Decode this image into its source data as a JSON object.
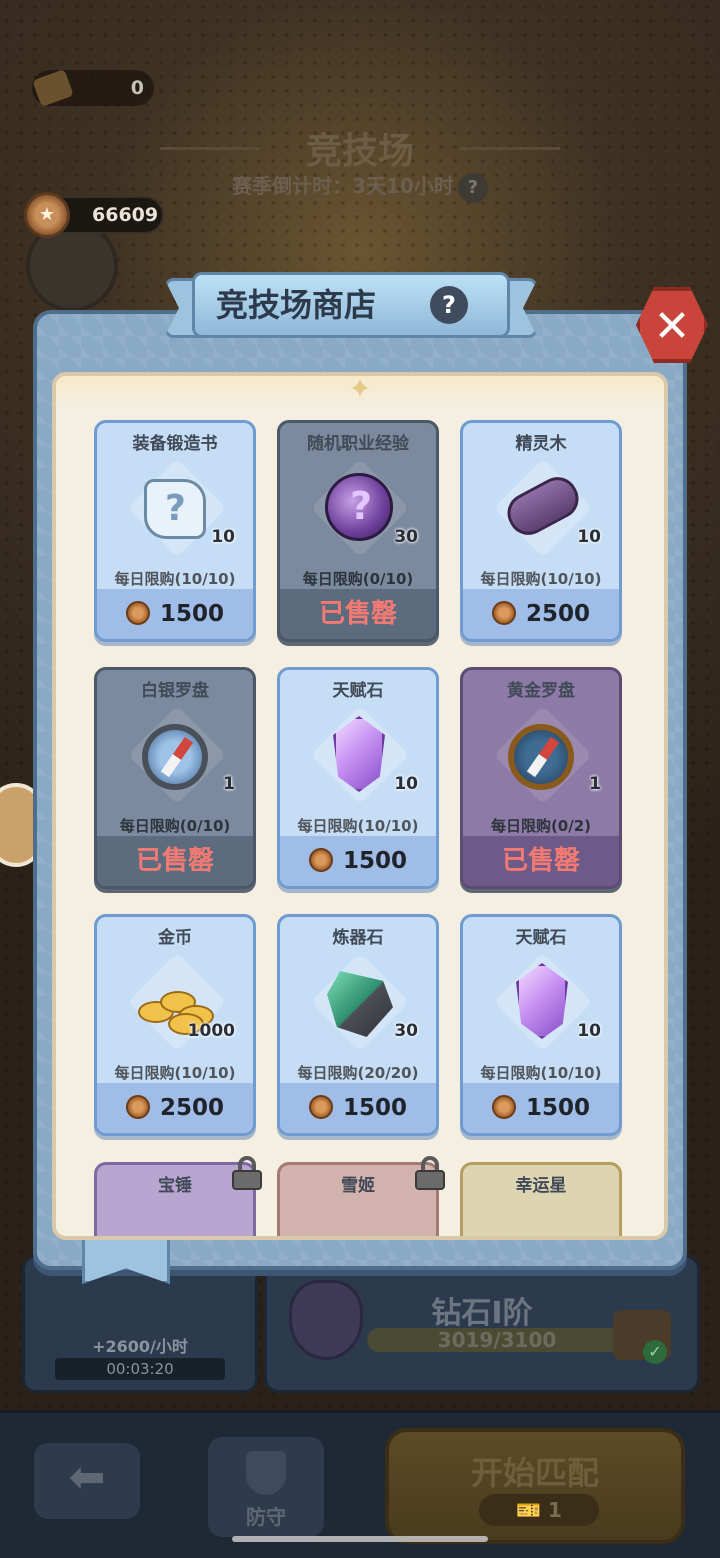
{
  "background": {
    "ticket_count": "0",
    "arena_title": "竞技场",
    "season_countdown": "赛季倒计时：3天10小时",
    "coin_balance": "66609",
    "income_rate": "+2600/小时",
    "income_timer": "00:03:20",
    "rank_name": "钻石I阶",
    "rank_progress": "3019/3100",
    "rank_progress_fraction": 0.974,
    "back_button_glyph": "⬅",
    "defend_label": "防守",
    "match_label": "开始匹配",
    "match_cost": "1"
  },
  "modal": {
    "title": "竞技场商店",
    "help_glyph": "?",
    "close_glyph": "✕"
  },
  "items": [
    {
      "name": "装备锻造书",
      "icon": "scroll-icon",
      "count": "10",
      "limit": "每日限购(10/10)",
      "price": "1500",
      "sold_out": false
    },
    {
      "name": "随机职业经验",
      "icon": "orb-icon",
      "count": "30",
      "limit": "每日限购(0/10)",
      "price": "已售罄",
      "sold_out": true
    },
    {
      "name": "精灵木",
      "icon": "wood-icon",
      "count": "10",
      "limit": "每日限购(10/10)",
      "price": "2500",
      "sold_out": false
    },
    {
      "name": "白银罗盘",
      "icon": "silver-compass-icon",
      "count": "1",
      "limit": "每日限购(0/10)",
      "price": "已售罄",
      "sold_out": true
    },
    {
      "name": "天赋石",
      "icon": "talent-stone-icon",
      "count": "10",
      "limit": "每日限购(10/10)",
      "price": "1500",
      "sold_out": false
    },
    {
      "name": "黄金罗盘",
      "icon": "gold-compass-icon",
      "count": "1",
      "limit": "每日限购(0/2)",
      "price": "已售罄",
      "sold_out": true
    },
    {
      "name": "金币",
      "icon": "gold-coins-icon",
      "count": "1000",
      "limit": "每日限购(10/10)",
      "price": "2500",
      "sold_out": false
    },
    {
      "name": "炼器石",
      "icon": "refine-stone-icon",
      "count": "30",
      "limit": "每日限购(20/20)",
      "price": "1500",
      "sold_out": false
    },
    {
      "name": "天赋石",
      "icon": "talent-stone-icon",
      "count": "10",
      "limit": "每日限购(10/10)",
      "price": "1500",
      "sold_out": false
    },
    {
      "name": "宝锤",
      "icon": "lock-icon",
      "locked": true
    },
    {
      "name": "雪姬",
      "icon": "lock-icon",
      "locked": true
    },
    {
      "name": "幸运星",
      "icon": "",
      "locked": false
    }
  ]
}
